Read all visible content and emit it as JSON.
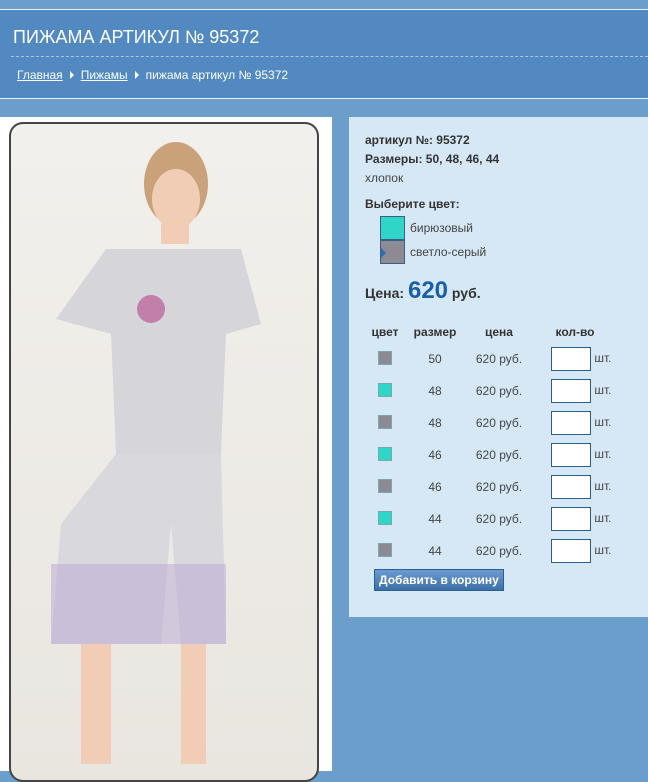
{
  "header": {
    "title": "ПИЖАМА АРТИКУЛ № 95372",
    "breadcrumbs": [
      "Главная",
      "Пижамы",
      "пижама артикул № 95372"
    ]
  },
  "product": {
    "article": "артикул №: 95372",
    "sizes": "Размеры: 50, 48, 46, 44",
    "material": "хлопок",
    "choose_color": "Выберите цвет:",
    "colors": [
      {
        "name": "бирюзовый",
        "hex": "#2fd6c8"
      },
      {
        "name": "светло-серый",
        "hex": "#8e8a94"
      }
    ],
    "price_label": "Цена:",
    "price": "620",
    "currency": "руб."
  },
  "table": {
    "headers": [
      "цвет",
      "размер",
      "цена",
      "кол-во"
    ],
    "unit": "шт.",
    "rows": [
      {
        "color": "#8e8a94",
        "size": "50",
        "price": "620 руб."
      },
      {
        "color": "#2fd6c8",
        "size": "48",
        "price": "620 руб."
      },
      {
        "color": "#8e8a94",
        "size": "48",
        "price": "620 руб."
      },
      {
        "color": "#2fd6c8",
        "size": "46",
        "price": "620 руб."
      },
      {
        "color": "#8e8a94",
        "size": "46",
        "price": "620 руб."
      },
      {
        "color": "#2fd6c8",
        "size": "44",
        "price": "620 руб."
      },
      {
        "color": "#8e8a94",
        "size": "44",
        "price": "620 руб."
      }
    ]
  },
  "add_to_cart": "Добавить в корзину"
}
